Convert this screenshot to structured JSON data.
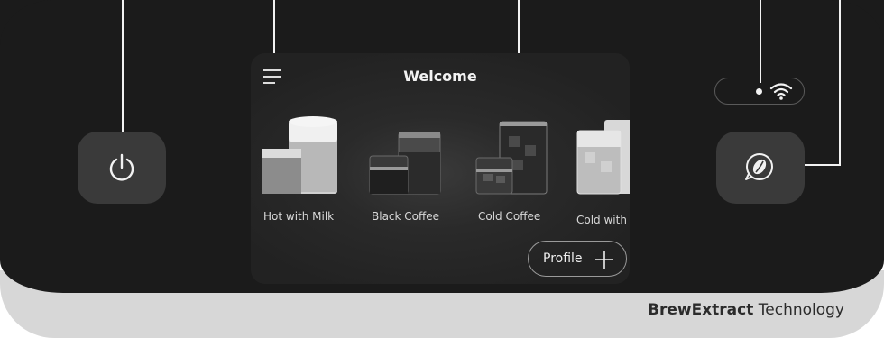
{
  "screen": {
    "title": "Welcome",
    "drinks": [
      {
        "label": "Hot with Milk"
      },
      {
        "label": "Black Coffee"
      },
      {
        "label": "Cold Coffee"
      },
      {
        "label": "Cold with Milk"
      }
    ],
    "profile_label": "Profile"
  },
  "brand": {
    "bold": "BrewExtract",
    "rest": " Technology"
  },
  "icons": {
    "power": "power-icon",
    "menu": "menu-icon",
    "wifi": "wifi-icon",
    "bean": "coffee-bean-icon",
    "add": "plus-icon"
  },
  "colors": {
    "panel": "#1b1b1b",
    "base": "#d7d7d7",
    "button": "#3a3a3a",
    "screen": "#2a2a2a"
  }
}
